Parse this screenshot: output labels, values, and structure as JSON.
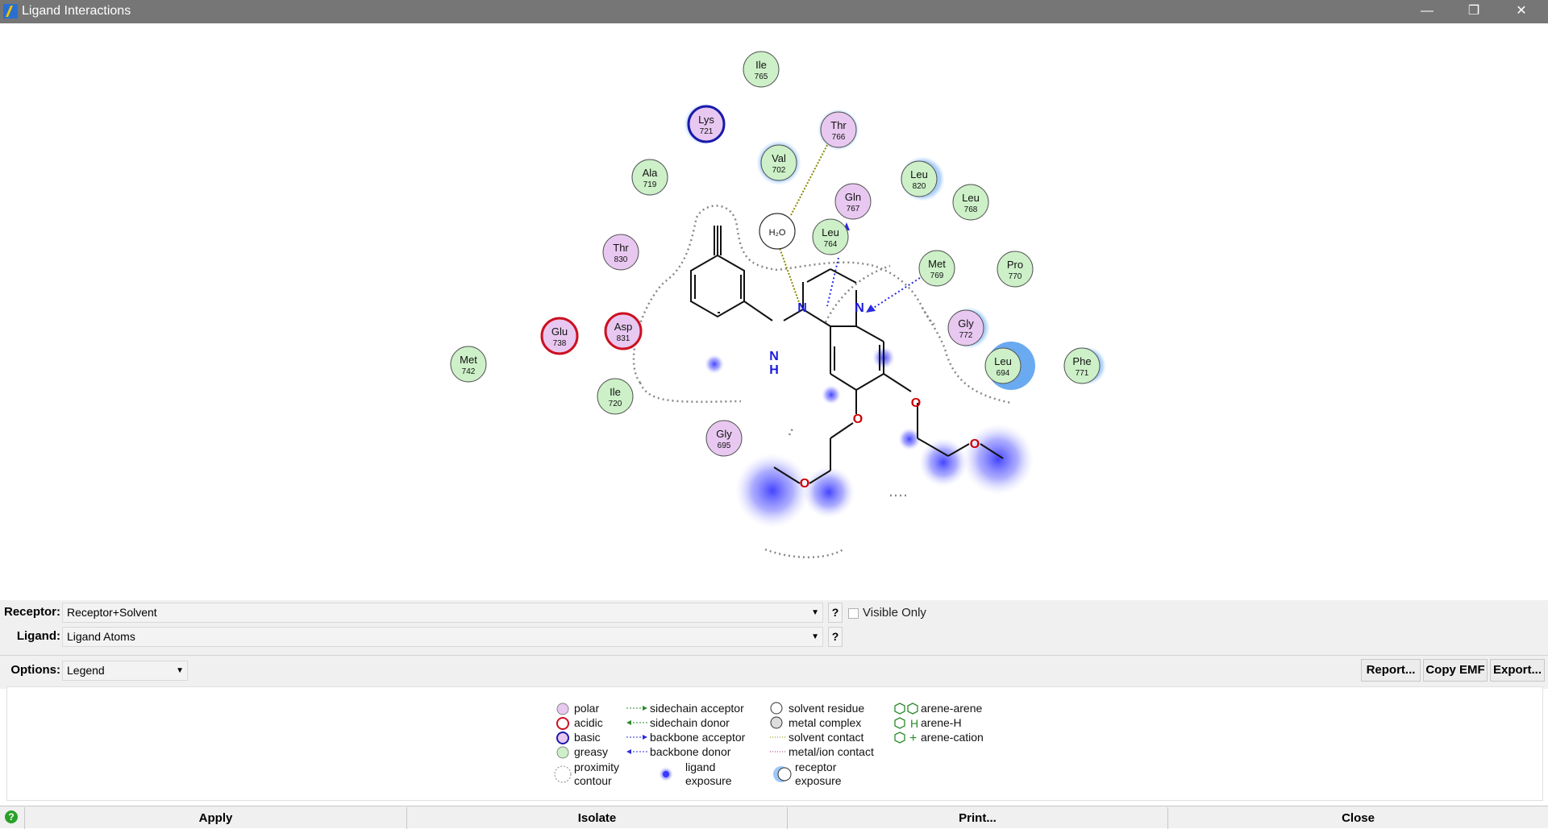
{
  "window": {
    "title": "Ligand Interactions",
    "minimize": "—",
    "maximize": "❐",
    "close": "✕"
  },
  "residues": [
    {
      "name": "Ile",
      "num": "765",
      "type": "greasy"
    },
    {
      "name": "Lys",
      "num": "721",
      "type": "basic"
    },
    {
      "name": "Thr",
      "num": "766",
      "type": "polar"
    },
    {
      "name": "Val",
      "num": "702",
      "type": "greasy"
    },
    {
      "name": "Ala",
      "num": "719",
      "type": "greasy"
    },
    {
      "name": "Leu",
      "num": "820",
      "type": "greasy"
    },
    {
      "name": "Leu",
      "num": "768",
      "type": "greasy"
    },
    {
      "name": "Gln",
      "num": "767",
      "type": "polar"
    },
    {
      "name": "Leu",
      "num": "764",
      "type": "greasy"
    },
    {
      "name": "Thr",
      "num": "830",
      "type": "polar"
    },
    {
      "name": "Met",
      "num": "769",
      "type": "greasy"
    },
    {
      "name": "Pro",
      "num": "770",
      "type": "greasy"
    },
    {
      "name": "Glu",
      "num": "738",
      "type": "acidic"
    },
    {
      "name": "Asp",
      "num": "831",
      "type": "acidic"
    },
    {
      "name": "Gly",
      "num": "772",
      "type": "polar"
    },
    {
      "name": "Met",
      "num": "742",
      "type": "greasy"
    },
    {
      "name": "Leu",
      "num": "694",
      "type": "greasy"
    },
    {
      "name": "Phe",
      "num": "771",
      "type": "greasy"
    },
    {
      "name": "Ile",
      "num": "720",
      "type": "greasy"
    },
    {
      "name": "Gly",
      "num": "695",
      "type": "polar"
    }
  ],
  "water": {
    "label": "H₂O"
  },
  "atoms": {
    "n1": "N",
    "n2": "N",
    "nh_n": "N",
    "nh_h": "H",
    "o1": "O",
    "o2": "O",
    "o3": "O",
    "o4": "O"
  },
  "colors": {
    "polar": "#e8c8f0",
    "greasy": "#cdf0c8",
    "acidic": "#cc1020",
    "basic": "#1a1aaa",
    "exposure": "#3a3aff",
    "receptor_exposure": "#9cc8f8",
    "hbond": "#2a2ae0",
    "solvent": "#8a8a00"
  },
  "controls": {
    "receptor_label": "Receptor:",
    "receptor_value": "Receptor+Solvent",
    "ligand_label": "Ligand:",
    "ligand_value": "Ligand Atoms",
    "help": "?",
    "visible_only": "Visible Only",
    "options_label": "Options:",
    "options_value": "Legend",
    "report": "Report...",
    "copy_emf": "Copy EMF",
    "export": "Export..."
  },
  "legend": {
    "polar": "polar",
    "acidic": "acidic",
    "basic": "basic",
    "greasy": "greasy",
    "proximity": "proximity",
    "contour": "contour",
    "sidechain_acceptor": "sidechain acceptor",
    "sidechain_donor": "sidechain donor",
    "backbone_acceptor": "backbone acceptor",
    "backbone_donor": "backbone donor",
    "ligand": "ligand",
    "exposure": "exposure",
    "solvent_residue": "solvent residue",
    "metal_complex": "metal complex",
    "solvent_contact": "solvent contact",
    "metal_ion_contact": "metal/ion contact",
    "receptor": "receptor",
    "receptor_exposure": "exposure",
    "arene_arene": "arene-arene",
    "arene_h": "arene-H",
    "arene_cation": "arene-cation",
    "h_glyph": "H",
    "plus_glyph": "+"
  },
  "bottom": {
    "apply": "Apply",
    "isolate": "Isolate",
    "print": "Print...",
    "close": "Close"
  }
}
